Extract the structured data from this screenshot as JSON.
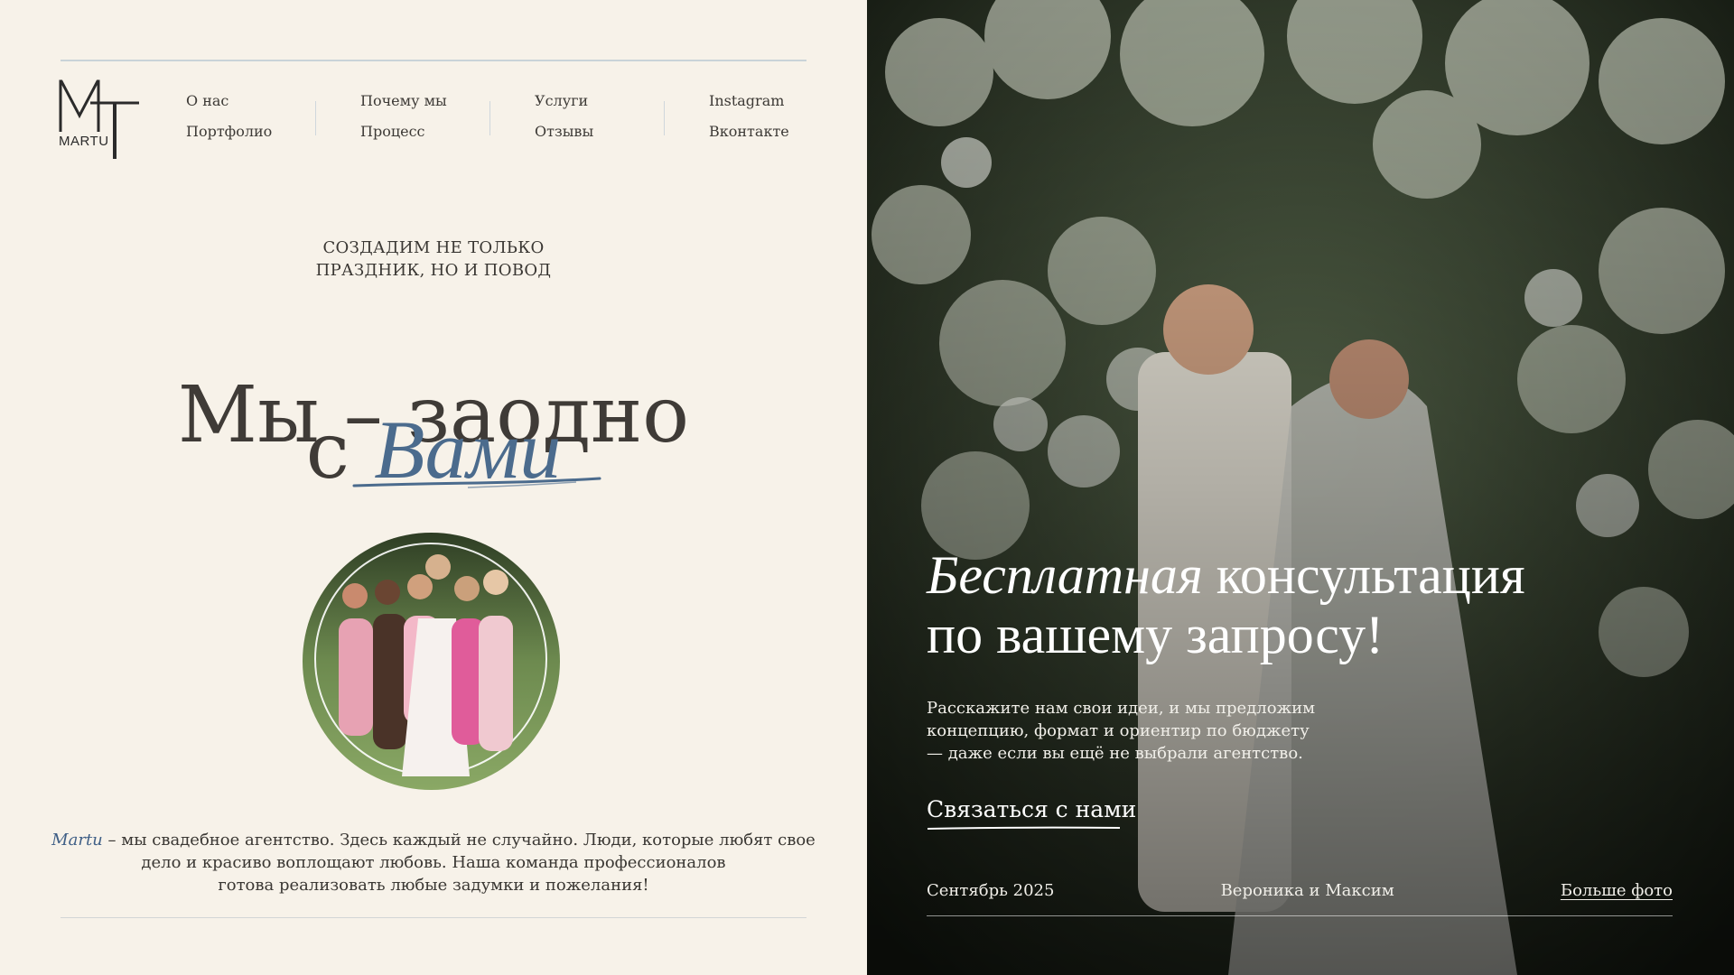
{
  "brand": {
    "logo_letters": "MT",
    "logo_word": "MARTU"
  },
  "nav": {
    "columns": [
      [
        "О нас",
        "Портфолио"
      ],
      [
        "Почему мы",
        "Процесс"
      ],
      [
        "Услуги",
        "Отзывы"
      ],
      [
        "Instagram",
        "Вконтакте"
      ]
    ]
  },
  "hero": {
    "tagline_line1": "СОЗДАДИМ НЕ ТОЛЬКО",
    "tagline_line2": "ПРАЗДНИК, НО И ПОВОД",
    "headline_line1": "Мы – заодно",
    "headline_prefix": "с",
    "headline_accent": "Вами"
  },
  "about": {
    "brand": "Martu",
    "line1_rest": " – мы свадебное агентство. Здесь каждый не случайно. Люди, которые любят свое",
    "line2": "дело и красиво воплощают любовь. Наша команда профессионалов",
    "line3": "готова реализовать любые задумки и пожелания!"
  },
  "promo": {
    "title_italic": "Бесплатная",
    "title_rest": " консультация",
    "title_line2": "по вашему запросу!",
    "text_line1": "Расскажите нам свои идеи, и мы предложим",
    "text_line2": "концепцию, формат и ориентир по бюджету",
    "text_line3": "— даже если вы ещё не выбрали агентство.",
    "cta": "Связаться с нами"
  },
  "footer": {
    "date": "Сентябрь 2025",
    "couple": "Вероника и Максим",
    "more": "Больше фото"
  },
  "colors": {
    "background": "#f7f2e9",
    "accent_blue": "#4b6b8d",
    "text_dark": "#3d3a36"
  }
}
